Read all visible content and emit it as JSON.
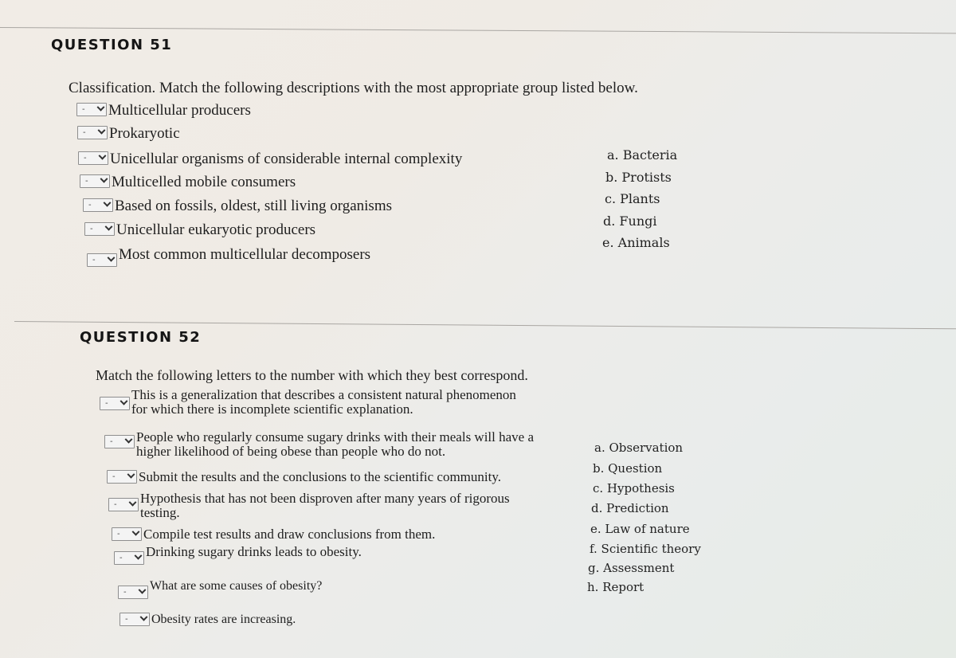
{
  "questions": [
    {
      "title": "QUESTION 51",
      "prompt": "Classification. Match the following descriptions with the most appropriate group listed below.",
      "items": [
        {
          "selected": "-",
          "text": "Multicellular producers"
        },
        {
          "selected": "-",
          "text": "Prokaryotic"
        },
        {
          "selected": "-",
          "text": "Unicellular organisms of considerable internal complexity"
        },
        {
          "selected": "-",
          "text": "Multicelled mobile consumers"
        },
        {
          "selected": "-",
          "text": "Based on fossils, oldest, still living organisms"
        },
        {
          "selected": "-",
          "text": "Unicellular eukaryotic producers"
        },
        {
          "selected": "-",
          "text": "Most common multicellular decomposers"
        }
      ],
      "options": [
        "a. Bacteria",
        "b. Protists",
        "c. Plants",
        "d. Fungi",
        "e. Animals"
      ]
    },
    {
      "title": "QUESTION 52",
      "prompt": "Match the following letters to the number with which they best correspond.",
      "items": [
        {
          "selected": "-",
          "text": "This is a generalization that describes a consistent natural phenomenon",
          "text2": "for which there is incomplete scientific explanation."
        },
        {
          "selected": "-",
          "text": "People who regularly consume sugary drinks with their meals will have a",
          "text2": "higher likelihood of being obese than people who do not."
        },
        {
          "selected": "-",
          "text": "Submit the results and the conclusions to the scientific community."
        },
        {
          "selected": "-",
          "text": "Hypothesis that has not been disproven after many years of rigorous",
          "text2": "testing."
        },
        {
          "selected": "-",
          "text": "Compile test results and draw conclusions from them."
        },
        {
          "selected": "-",
          "text": "Drinking sugary drinks leads to obesity."
        },
        {
          "selected": "-",
          "text": "What are some causes of obesity?"
        },
        {
          "selected": "-",
          "text": "Obesity rates are increasing."
        }
      ],
      "options": [
        "a. Observation",
        "b. Question",
        "c. Hypothesis",
        "d. Prediction",
        "e. Law of nature",
        "f. Scientific theory",
        "g. Assessment",
        "h. Report"
      ]
    }
  ]
}
